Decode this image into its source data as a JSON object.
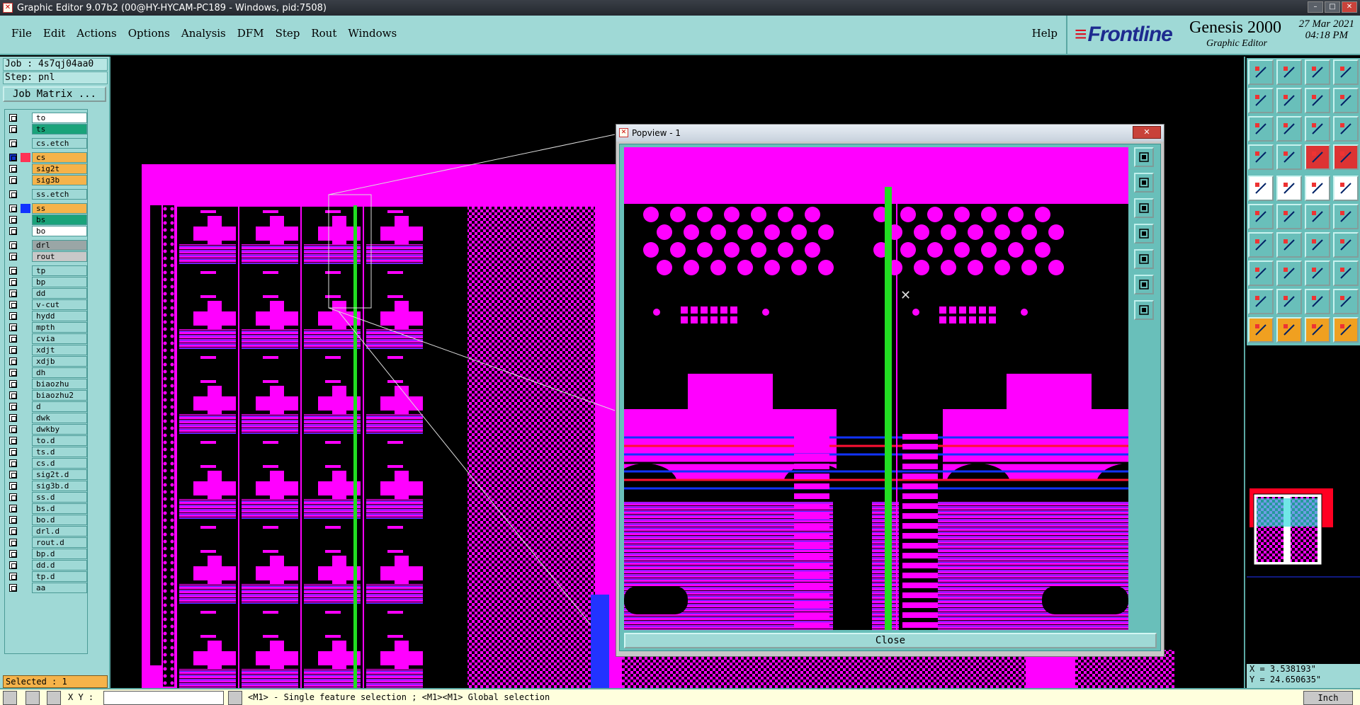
{
  "window": {
    "title": "Graphic Editor 9.07b2 (00@HY-HYCAM-PC189 - Windows, pid:7508)"
  },
  "menu": {
    "items": [
      "File",
      "Edit",
      "Actions",
      "Options",
      "Analysis",
      "DFM",
      "Step",
      "Rout",
      "Windows"
    ],
    "help": "Help"
  },
  "brand": {
    "logo": "Frontline",
    "product": "Genesis 2000",
    "subtitle": "Graphic Editor",
    "date": "27 Mar 2021",
    "time": "04:18 PM"
  },
  "job": {
    "job_label": "Job : 4s7qj04aa0",
    "step_label": "Step: pnl",
    "matrix_button": "Job Matrix ..."
  },
  "layers": [
    {
      "name": "to",
      "color": "#ffffff"
    },
    {
      "name": "ts",
      "color": "#1aa37a"
    },
    {
      "name": "cs.etch",
      "color": "#9fd9d6"
    },
    {
      "name": "cs",
      "color": "#f5b34a",
      "active": true
    },
    {
      "name": "sig2t",
      "color": "#f5b34a"
    },
    {
      "name": "sig3b",
      "color": "#f5b34a"
    },
    {
      "name": "ss.etch",
      "color": "#9fd9d6"
    },
    {
      "name": "ss",
      "color": "#f5b34a",
      "blue": true
    },
    {
      "name": "bs",
      "color": "#1aa37a"
    },
    {
      "name": "bo",
      "color": "#ffffff"
    },
    {
      "name": "drl",
      "color": "#9aa6a6"
    },
    {
      "name": "rout",
      "color": "#c8c8c8"
    },
    {
      "name": "tp",
      "color": "#9fd9d6"
    },
    {
      "name": "bp",
      "color": "#9fd9d6"
    },
    {
      "name": "dd",
      "color": "#9fd9d6"
    },
    {
      "name": "v-cut",
      "color": "#9fd9d6"
    },
    {
      "name": "hydd",
      "color": "#9fd9d6"
    },
    {
      "name": "mpth",
      "color": "#9fd9d6"
    },
    {
      "name": "cvia",
      "color": "#9fd9d6"
    },
    {
      "name": "xdjt",
      "color": "#9fd9d6"
    },
    {
      "name": "xdjb",
      "color": "#9fd9d6"
    },
    {
      "name": "dh",
      "color": "#9fd9d6"
    },
    {
      "name": "biaozhu",
      "color": "#9fd9d6"
    },
    {
      "name": "biaozhu2",
      "color": "#9fd9d6"
    },
    {
      "name": "d",
      "color": "#9fd9d6"
    },
    {
      "name": "dwk",
      "color": "#9fd9d6"
    },
    {
      "name": "dwkby",
      "color": "#9fd9d6"
    },
    {
      "name": "to.d",
      "color": "#9fd9d6"
    },
    {
      "name": "ts.d",
      "color": "#9fd9d6"
    },
    {
      "name": "cs.d",
      "color": "#9fd9d6"
    },
    {
      "name": "sig2t.d",
      "color": "#9fd9d6"
    },
    {
      "name": "sig3b.d",
      "color": "#9fd9d6"
    },
    {
      "name": "ss.d",
      "color": "#9fd9d6"
    },
    {
      "name": "bs.d",
      "color": "#9fd9d6"
    },
    {
      "name": "bo.d",
      "color": "#9fd9d6"
    },
    {
      "name": "drl.d",
      "color": "#9fd9d6"
    },
    {
      "name": "rout.d",
      "color": "#9fd9d6"
    },
    {
      "name": "bp.d",
      "color": "#9fd9d6"
    },
    {
      "name": "dd.d",
      "color": "#9fd9d6"
    },
    {
      "name": "tp.d",
      "color": "#9fd9d6"
    },
    {
      "name": "aa",
      "color": "#9fd9d6"
    }
  ],
  "selection": {
    "label": "Selected : 1"
  },
  "popview": {
    "title": "Popview - 1",
    "close_label": "Close"
  },
  "coords": {
    "x": "X = 3.538193\"",
    "y": "Y = 24.650635\""
  },
  "status": {
    "xy_label": "X Y :",
    "hint": "<M1> - Single feature selection ; <M1><M1> Global selection",
    "unit": "Inch"
  },
  "colors": {
    "panel": "#9fd9d6",
    "magenta": "#ff00ff",
    "green": "#22dd22",
    "blue": "#1133ff",
    "red": "#ff1133"
  }
}
